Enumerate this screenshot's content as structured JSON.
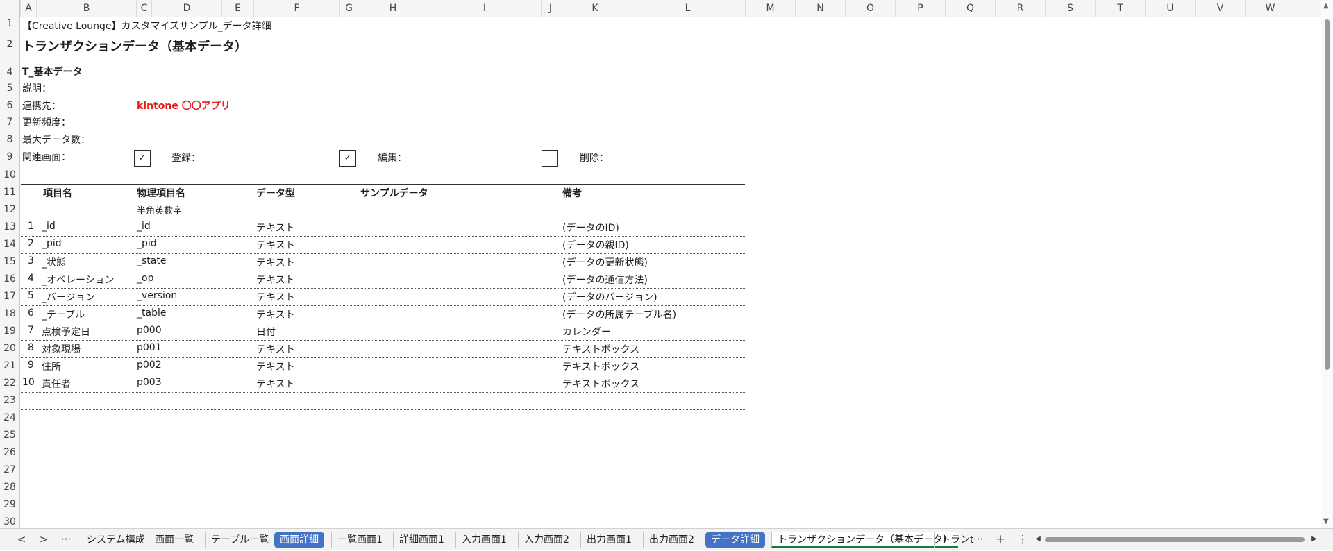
{
  "columns": [
    "A",
    "B",
    "C",
    "D",
    "E",
    "F",
    "G",
    "H",
    "I",
    "J",
    "K",
    "L",
    "M",
    "N",
    "O",
    "P",
    "Q",
    "R",
    "S",
    "T",
    "U",
    "V",
    "W"
  ],
  "rows": [
    "1",
    "2",
    "3",
    "4",
    "5",
    "6",
    "7",
    "8",
    "9",
    "10",
    "11",
    "12",
    "13",
    "14",
    "15",
    "16",
    "17",
    "18",
    "19",
    "20",
    "21",
    "22",
    "23",
    "24",
    "25",
    "26",
    "27",
    "28",
    "29",
    "30"
  ],
  "doc": {
    "title": "【Creative Lounge】カスタマイズサンプル_データ詳細",
    "sheet_title": "トランザクションデータ（基本データ）",
    "section": "T_基本データ",
    "desc_label": "説明：",
    "link_label": "連携先：",
    "link_value": "kintone 〇〇アプリ",
    "freq_label": "更新頻度：",
    "max_label": "最大データ数：",
    "screen_label": "関連画面：",
    "check_register_mark": "✓",
    "register_label": "登録：",
    "check_edit_mark": "✓",
    "edit_label": "編集：",
    "check_delete_mark": "",
    "delete_label": "削除："
  },
  "table": {
    "headers": {
      "item": "項目名",
      "physical": "物理項目名",
      "type": "データ型",
      "sample": "サンプルデータ",
      "note": "備考"
    },
    "subheader": "半角英数字",
    "rows": [
      {
        "no": "1",
        "name": "_id",
        "physical": "_id",
        "type": "テキスト",
        "note": "(データのID)"
      },
      {
        "no": "2",
        "name": "_pid",
        "physical": "_pid",
        "type": "テキスト",
        "note": "(データの親ID)"
      },
      {
        "no": "3",
        "name": "_状態",
        "physical": "_state",
        "type": "テキスト",
        "note": "(データの更新状態)"
      },
      {
        "no": "4",
        "name": "_オペレーション",
        "physical": "_op",
        "type": "テキスト",
        "note": "(データの通信方法)"
      },
      {
        "no": "5",
        "name": "_バージョン",
        "physical": "_version",
        "type": "テキスト",
        "note": "(データのバージョン)"
      },
      {
        "no": "6",
        "name": "_テーブル",
        "physical": "_table",
        "type": "テキスト",
        "note": "(データの所属テーブル名)"
      },
      {
        "no": "7",
        "name": "点検予定日",
        "physical": "p000",
        "type": "日付",
        "note": "カレンダー"
      },
      {
        "no": "8",
        "name": "対象現場",
        "physical": "p001",
        "type": "テキスト",
        "note": "テキストボックス"
      },
      {
        "no": "9",
        "name": "住所",
        "physical": "p002",
        "type": "テキスト",
        "note": "テキストボックス"
      },
      {
        "no": "10",
        "name": "責任者",
        "physical": "p003",
        "type": "テキスト",
        "note": "テキストボックス"
      }
    ]
  },
  "tabs": {
    "prev": "<",
    "next": ">",
    "more_left": "···",
    "items": [
      {
        "label": "システム構成",
        "style": "normal"
      },
      {
        "label": "画面一覧",
        "style": "normal"
      },
      {
        "label": "テーブル一覧",
        "style": "normal"
      },
      {
        "label": "画面詳細",
        "style": "hl"
      },
      {
        "label": "一覧画面1",
        "style": "normal"
      },
      {
        "label": "詳細画面1",
        "style": "normal"
      },
      {
        "label": "入力画面1",
        "style": "normal"
      },
      {
        "label": "入力画面2",
        "style": "normal"
      },
      {
        "label": "出力画面1",
        "style": "normal"
      },
      {
        "label": "出力画面2",
        "style": "normal"
      },
      {
        "label": "データ詳細",
        "style": "hl"
      },
      {
        "label": "トランザクションデータ（基本データ）",
        "style": "active"
      },
      {
        "label": "トランt",
        "style": "normal"
      }
    ],
    "more_right": "···",
    "add": "+",
    "options": "⋮"
  },
  "colors": {
    "accent_tab": "#4472c4",
    "active_underline": "#107c41",
    "link_red": "#e81b1b"
  }
}
